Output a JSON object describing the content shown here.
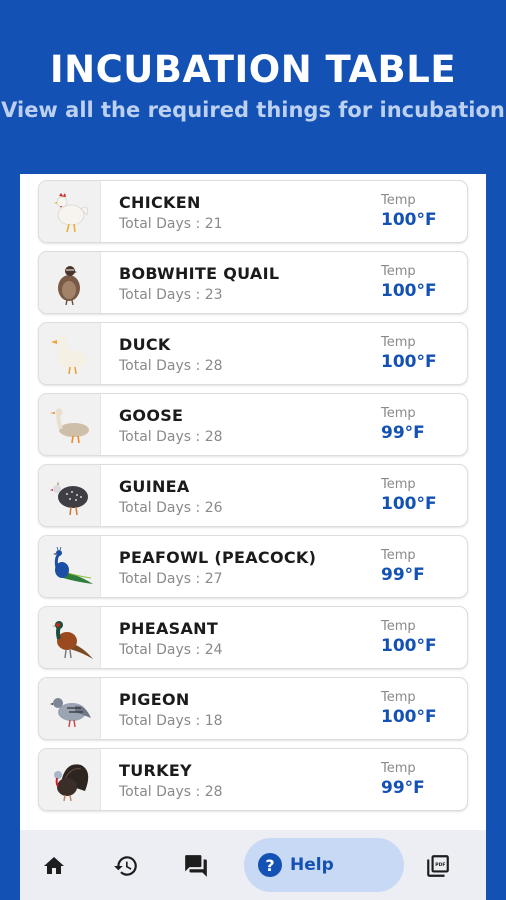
{
  "header": {
    "title": "INCUBATION TABLE",
    "subtitle": "View all the required things for incubation"
  },
  "colors": {
    "brand": "#1351b4",
    "help_bg": "#c7d9f4"
  },
  "birds": [
    {
      "name": "CHICKEN",
      "days": "Total Days : 21",
      "temp_label": "Temp",
      "temp": "100°F",
      "icon": "chicken-icon"
    },
    {
      "name": "BOBWHITE QUAIL",
      "days": "Total Days : 23",
      "temp_label": "Temp",
      "temp": "100°F",
      "icon": "quail-icon"
    },
    {
      "name": "DUCK",
      "days": "Total Days : 28",
      "temp_label": "Temp",
      "temp": "100°F",
      "icon": "duck-icon"
    },
    {
      "name": "GOOSE",
      "days": "Total Days : 28",
      "temp_label": "Temp",
      "temp": "99°F",
      "icon": "goose-icon"
    },
    {
      "name": "GUINEA",
      "days": "Total Days : 26",
      "temp_label": "Temp",
      "temp": "100°F",
      "icon": "guinea-icon"
    },
    {
      "name": "PEAFOWL (PEACOCK)",
      "days": "Total Days : 27",
      "temp_label": "Temp",
      "temp": "99°F",
      "icon": "peacock-icon"
    },
    {
      "name": "PHEASANT",
      "days": "Total Days : 24",
      "temp_label": "Temp",
      "temp": "100°F",
      "icon": "pheasant-icon"
    },
    {
      "name": "PIGEON",
      "days": "Total Days : 18",
      "temp_label": "Temp",
      "temp": "100°F",
      "icon": "pigeon-icon"
    },
    {
      "name": "TURKEY",
      "days": "Total Days : 28",
      "temp_label": "Temp",
      "temp": "99°F",
      "icon": "turkey-icon"
    }
  ],
  "nav": {
    "help_label": "Help",
    "items": [
      "home-icon",
      "history-icon",
      "chat-icon",
      "help-icon",
      "pdf-icon"
    ]
  }
}
